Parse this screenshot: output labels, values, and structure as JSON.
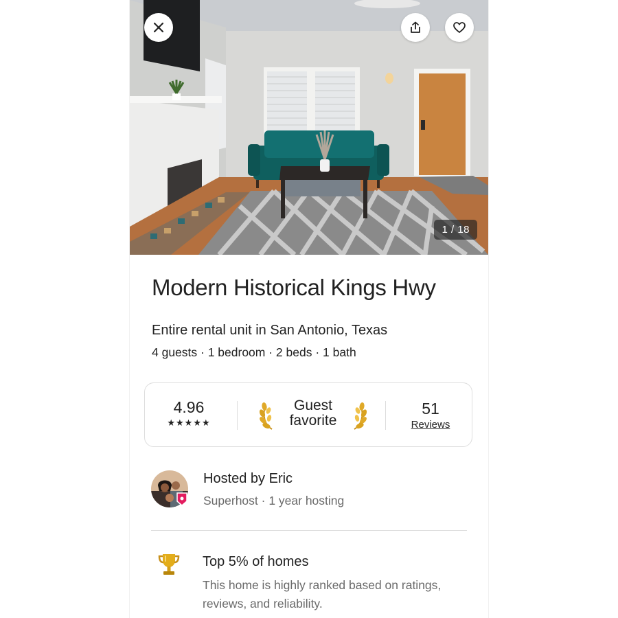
{
  "photo": {
    "counter": "1 / 18"
  },
  "header": {
    "close_icon": "close-icon",
    "share_icon": "share-icon",
    "save_icon": "heart-icon"
  },
  "listing": {
    "title": "Modern Historical Kings Hwy",
    "subtitle": "Entire rental unit in San Antonio, Texas",
    "details": "4 guests · 1 bedroom · 2 beds · 1 bath"
  },
  "rating_card": {
    "rating": "4.96",
    "stars": "★★★★★",
    "badge_line1": "Guest",
    "badge_line2": "favorite",
    "reviews_count": "51",
    "reviews_label": "Reviews"
  },
  "host": {
    "name": "Hosted by Eric",
    "meta": "Superhost · 1 year hosting"
  },
  "highlight": {
    "icon": "trophy-icon",
    "title": "Top 5% of homes",
    "description": "This home is highly ranked based on ratings, reviews, and reliability."
  },
  "colors": {
    "text": "#222222",
    "secondary_text": "#6a6a6a",
    "border": "#dddddd",
    "superhost_badge": "#e31c5f",
    "laurel_gold": "#d9a21f"
  }
}
